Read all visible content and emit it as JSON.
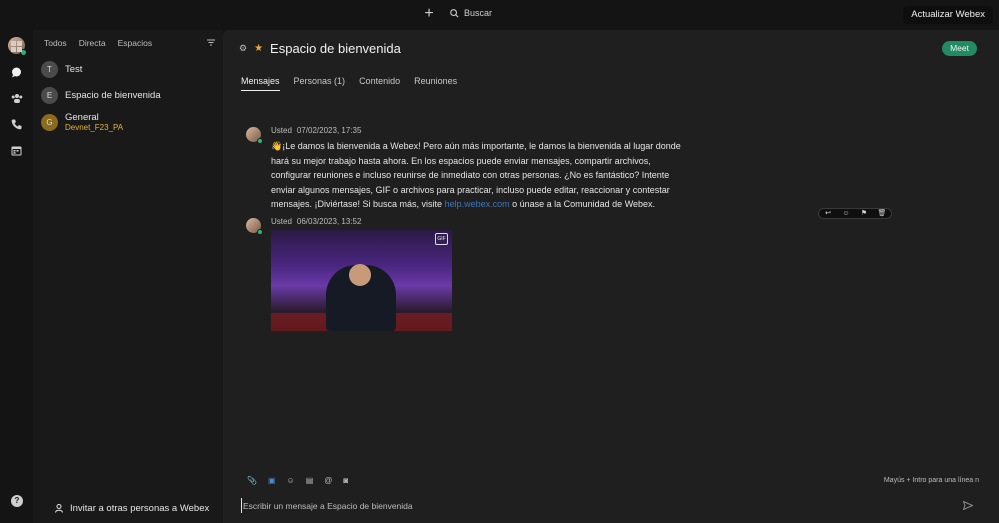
{
  "topbar": {
    "new_icon": "plus-icon",
    "search_label": "Buscar",
    "update_label": "Actualizar Webex"
  },
  "rail": {
    "items": [
      {
        "icon": "dashboard-icon"
      },
      {
        "icon": "messaging-icon"
      },
      {
        "icon": "teams-icon"
      },
      {
        "icon": "calls-icon"
      },
      {
        "icon": "calendar-icon"
      }
    ],
    "help_icon": "help-icon"
  },
  "list": {
    "filters": [
      "Todos",
      "Directa",
      "Espacios"
    ],
    "conversations": [
      {
        "initial": "T",
        "name": "Test",
        "sub": ""
      },
      {
        "initial": "E",
        "name": "Espacio de bienvenida",
        "sub": ""
      },
      {
        "initial": "G",
        "name": "General",
        "sub": "Devnet_F23_PA"
      }
    ],
    "invite_label": "Invitar a otras personas a Webex"
  },
  "space": {
    "title": "Espacio de bienvenida",
    "meet_label": "Meet",
    "tabs": [
      "Mensajes",
      "Personas (1)",
      "Contenido",
      "Reuniones"
    ]
  },
  "messages": [
    {
      "author": "Usted",
      "time": "07/02/2023, 17:35",
      "text_before": "👋¡Le damos la bienvenida a Webex! Pero aún más importante, le damos la bienvenida al lugar donde hará su mejor trabajo hasta ahora. En los espacios puede enviar mensajes, compartir archivos, configurar reuniones e incluso reunirse de inmediato con otras personas. ¿No es fantástico? Intente enviar algunos mensajes, GIF o archivos para practicar, incluso puede editar, reaccionar y contestar mensajes. ¡Diviértase! Si busca más, visite ",
      "link": "help.webex.com",
      "text_after": " o únase a la Comunidad de Webex."
    },
    {
      "author": "Usted",
      "time": "06/03/2023, 13:52",
      "gif_badge": "GIF"
    }
  ],
  "composer": {
    "hint": "Mayús + Intro para una línea n",
    "placeholder": "Escribir un mensaje a Espacio de bienvenida"
  },
  "colors": {
    "accent_green": "#218b63",
    "star": "#f2a93b",
    "link": "#3f77b8",
    "presence": "#29b37a"
  }
}
